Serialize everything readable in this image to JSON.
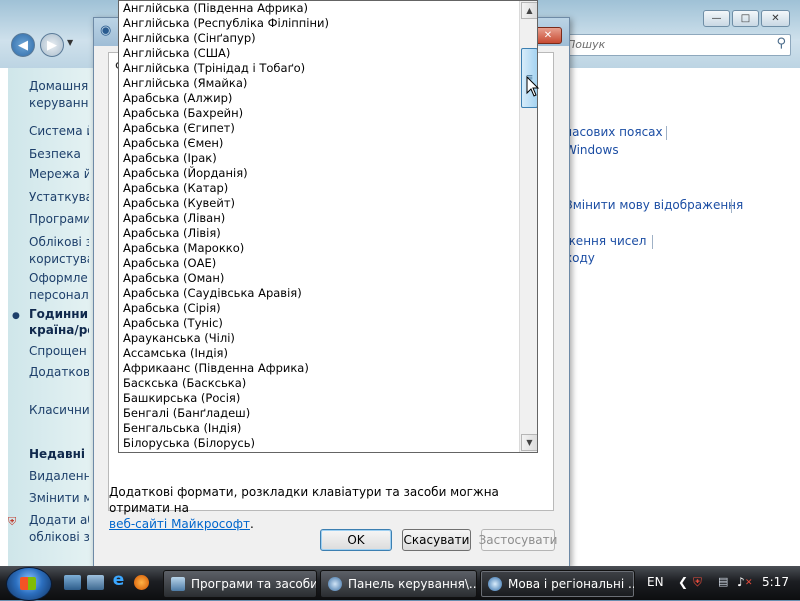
{
  "control_panel": {
    "search_placeholder": "Пошук",
    "sidebar": [
      {
        "label": "Домашня",
        "bold": false
      },
      {
        "label": "керування",
        "bold": false
      },
      {
        "label": "Система й",
        "bold": false
      },
      {
        "label": "Безпека",
        "bold": false
      },
      {
        "label": "Мережа й",
        "bold": false
      },
      {
        "label": "Устаткува",
        "bold": false
      },
      {
        "label": "Програми",
        "bold": false
      },
      {
        "label": "Облікові з",
        "bold": false
      },
      {
        "label": "користува",
        "bold": false
      },
      {
        "label": "Оформле",
        "bold": false
      },
      {
        "label": "персонал",
        "bold": false
      },
      {
        "label": "Годинник",
        "bold": true
      },
      {
        "label": "країна/ре",
        "bold": true
      },
      {
        "label": "Спрощен",
        "bold": false
      },
      {
        "label": "Додатков",
        "bold": false
      },
      {
        "label": "Класични",
        "bold": false
      },
      {
        "label": "Недавні з",
        "bold": true
      },
      {
        "label": "Видалення",
        "bold": false
      },
      {
        "label": "Змінити м",
        "bold": false
      },
      {
        "label": "Додати аб",
        "bold": false
      },
      {
        "label": "облікові з",
        "bold": false
      }
    ],
    "main_links": [
      "часових поясах",
      "Windows",
      "Змінити мову відображення",
      "ження чисел",
      "ходу"
    ]
  },
  "dialog": {
    "tab_letter": "Ф",
    "info_text": "Додаткові формати, розкладки клавіатури та засоби могжна отримати на",
    "info_link": "веб-сайті Майкрософт",
    "info_end": ".",
    "buttons": {
      "ok": "OK",
      "cancel": "Скасувати",
      "apply": "Застосувати"
    }
  },
  "dropdown": {
    "items": [
      "Англійська (Південна Африка)",
      "Англійська (Республіка Філіппіни)",
      "Англійська (Сінґапур)",
      "Англійська (США)",
      "Англійська (Трінідад і Тобаґо)",
      "Англійська (Ямайка)",
      "Арабська (Алжир)",
      "Арабська (Бахрейн)",
      "Арабська (Єгипет)",
      "Арабська (Ємен)",
      "Арабська (Ірак)",
      "Арабська (Йорданія)",
      "Арабська (Катар)",
      "Арабська (Кувейт)",
      "Арабська (Ліван)",
      "Арабська (Лівія)",
      "Арабська (Марокко)",
      "Арабська (ОАЕ)",
      "Арабська (Оман)",
      "Арабська (Саудівська Аравія)",
      "Арабська (Сірія)",
      "Арабська (Туніс)",
      "Арауканська (Чілі)",
      "Ассамська (Індія)",
      "Африкаанс (Південна Африка)",
      "Баскська (Баскська)",
      "Башкирська (Росія)",
      "Бенгалі (Банґладеш)",
      "Бенгальська (Індія)",
      "Білоруська (Білорусь)"
    ]
  },
  "taskbar": {
    "buttons": [
      {
        "label": "Програми та засоби",
        "active": false
      },
      {
        "label": "Панель керування\\...",
        "active": false
      },
      {
        "label": "Мова і регіональні ...",
        "active": true
      }
    ],
    "tray": {
      "language": "EN",
      "clock": "5:17"
    }
  }
}
